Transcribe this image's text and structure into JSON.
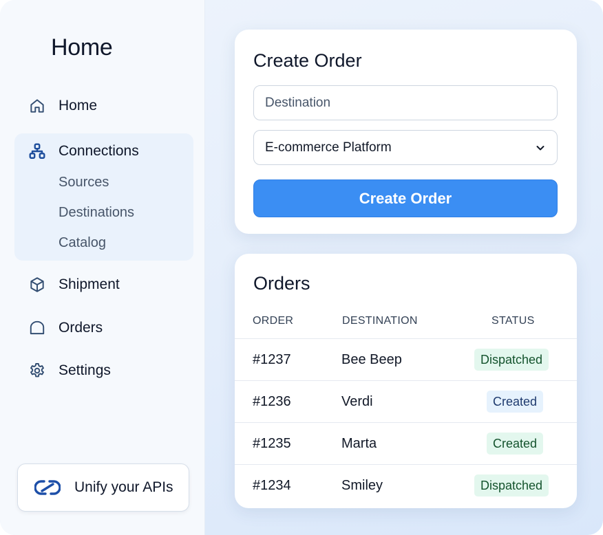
{
  "sidebar": {
    "title": "Home",
    "items": [
      {
        "label": "Home",
        "icon": "home-icon"
      },
      {
        "label": "Connections",
        "icon": "connections-icon"
      },
      {
        "label": "Shipment",
        "icon": "box-icon"
      },
      {
        "label": "Orders",
        "icon": "orders-icon"
      },
      {
        "label": "Settings",
        "icon": "gear-icon"
      }
    ],
    "sub_items": [
      "Sources",
      "Destinations",
      "Catalog"
    ],
    "promo": {
      "label": "Unify your APIs",
      "icon": "link-icon"
    }
  },
  "create_order": {
    "title": "Create Order",
    "destination_placeholder": "Destination",
    "destination_value": "",
    "platform_selected": "E-commerce Platform",
    "button_label": "Create Order"
  },
  "orders": {
    "title": "Orders",
    "columns": [
      "ORDER",
      "DESTINATION",
      "STATUS"
    ],
    "rows": [
      {
        "order": "#1237",
        "destination": "Bee Beep",
        "status": "Dispatched"
      },
      {
        "order": "#1236",
        "destination": "Verdi",
        "status": "Created"
      },
      {
        "order": "#1235",
        "destination": "Marta",
        "status": "Created"
      },
      {
        "order": "#1234",
        "destination": "Smiley",
        "status": "Dispatched"
      }
    ]
  },
  "colors": {
    "accent": "#3b8ef3",
    "icon": "#1e4e9c",
    "status_green_bg": "#e3f7ee",
    "status_blue_bg": "#e6f2fd"
  }
}
